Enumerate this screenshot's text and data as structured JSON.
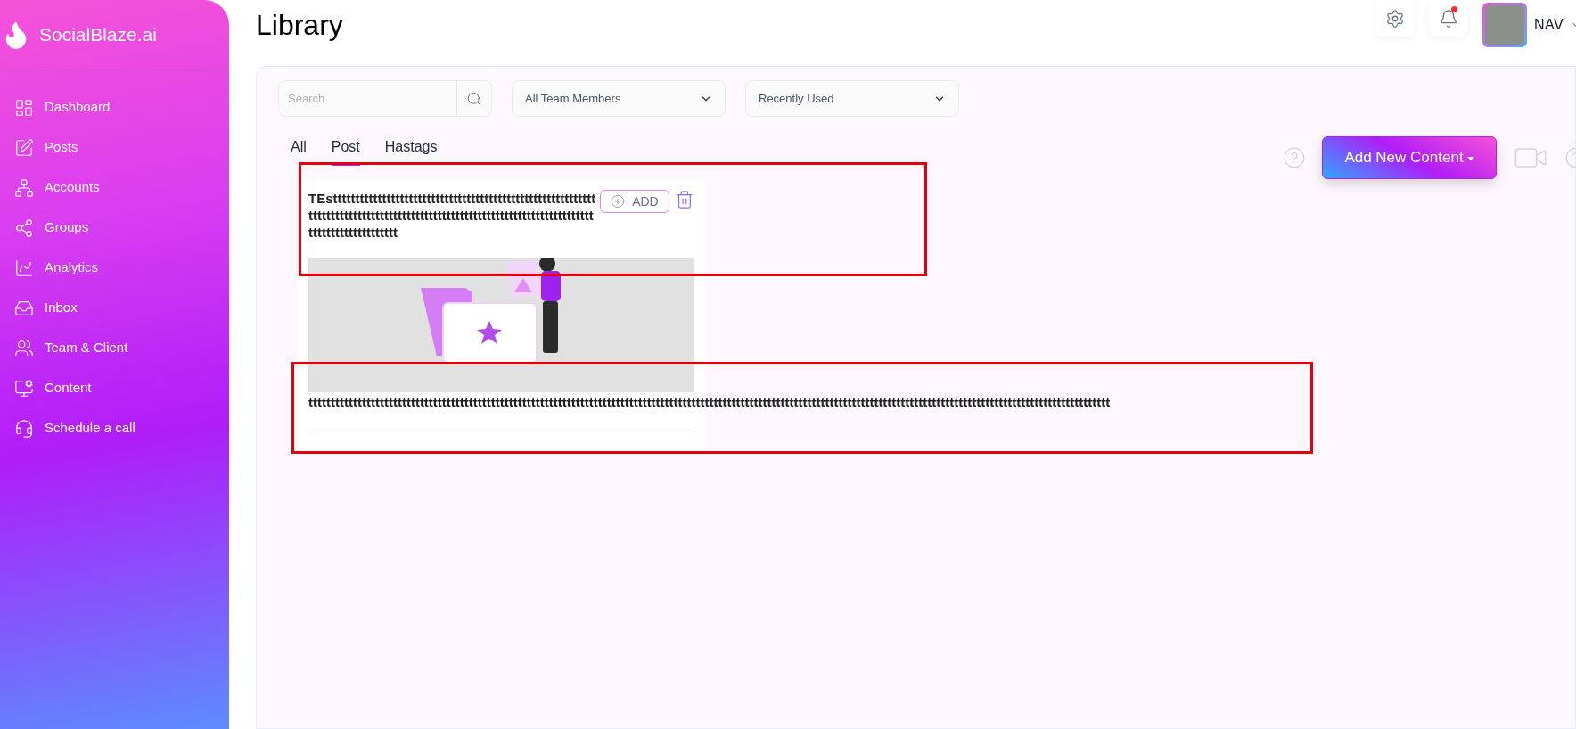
{
  "sidebar": {
    "brand": "SocialBlaze.ai",
    "items": [
      {
        "label": "Dashboard",
        "kind": "dashboard"
      },
      {
        "label": "Posts",
        "kind": "posts"
      },
      {
        "label": "Accounts",
        "kind": "accounts"
      },
      {
        "label": "Groups",
        "kind": "groups"
      },
      {
        "label": "Analytics",
        "kind": "analytics"
      },
      {
        "label": "Inbox",
        "kind": "inbox"
      },
      {
        "label": "Team & Client",
        "kind": "team"
      },
      {
        "label": "Content",
        "kind": "content"
      },
      {
        "label": "Schedule a call",
        "kind": "call"
      }
    ]
  },
  "header": {
    "title": "Library",
    "notifications": {
      "unread": true
    },
    "user": {
      "name": "NAV"
    }
  },
  "filters": {
    "search": {
      "placeholder": "Search"
    },
    "selects": [
      {
        "value": "All Team Members"
      },
      {
        "value": "Recently Used"
      }
    ]
  },
  "tabs": [
    {
      "label": "All",
      "selected": false
    },
    {
      "label": "Post",
      "selected": true
    },
    {
      "label": "Hastags",
      "selected": false
    }
  ],
  "actions": {
    "add_button": "Add New Content"
  },
  "cards": [
    {
      "title": "TEsttttttttttttttttttttttttttttttttttttttttttttttttttttttttttttttttttttttttttttttttttttttttttttttttttttttttttttttttttttttttttttttttttttttttttttttt",
      "add_button": "ADD",
      "caption": "tttttttttttttttttttttttttttttttttttttttttttttttttttttttttttttttttttttttttttttttttttttttttttttttttttttttttttttttttttttttttttttttttttttttttttttttttttttttttttttttttttttttttttttttttttt"
    }
  ]
}
